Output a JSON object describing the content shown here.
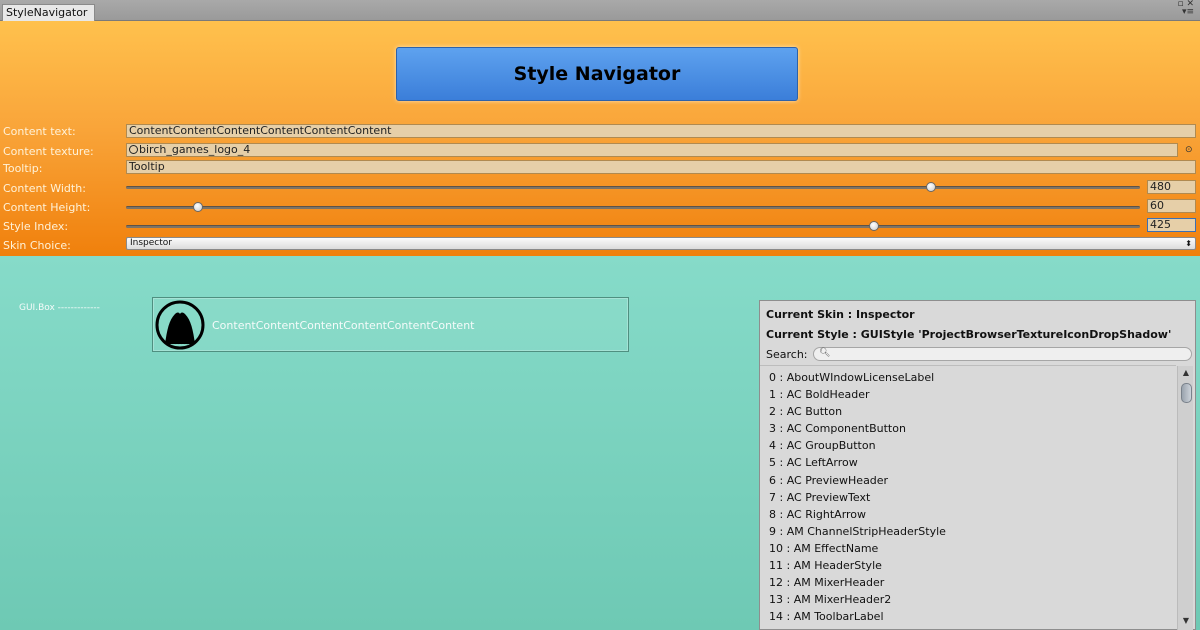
{
  "window": {
    "tab_title": "StyleNavigator",
    "controls": "▫ ✕\n▾≡"
  },
  "header": {
    "title_button": "Style Navigator"
  },
  "fields": {
    "content_text": {
      "label": "Content text:",
      "value": "ContentContentContentContentContentContent"
    },
    "content_texture": {
      "label": "Content texture:",
      "value": "birch_games_logo_4",
      "icon": "texture-circle-icon"
    },
    "tooltip": {
      "label": "Tooltip:",
      "value": "Tooltip"
    },
    "content_width": {
      "label": "Content Width:",
      "value": "480",
      "fraction": 0.794
    },
    "content_height": {
      "label": "Content Height:",
      "value": "60",
      "fraction": 0.071
    },
    "style_index": {
      "label": "Style Index:",
      "value": "425",
      "fraction": 0.738
    },
    "skin_choice": {
      "label": "Skin Choice:",
      "value": "Inspector"
    }
  },
  "preview": {
    "label": "GUI.Box -------------",
    "content_text": "ContentContentContentContentContentContent",
    "logo_icon": "birch-games-logo-icon"
  },
  "panel": {
    "current_skin": "Current Skin : Inspector",
    "current_style": "Current Style : GUIStyle 'ProjectBrowserTextureIconDropShadow'",
    "search_label": "Search:",
    "search_value": "",
    "items": [
      "0 : AboutWIndowLicenseLabel",
      "1 : AC BoldHeader",
      "2 : AC Button",
      "3 : AC ComponentButton",
      "4 : AC GroupButton",
      "5 : AC LeftArrow",
      "6 : AC PreviewHeader",
      "7 : AC PreviewText",
      "8 : AC RightArrow",
      "9 : AM ChannelStripHeaderStyle",
      "10 : AM EffectName",
      "11 : AM HeaderStyle",
      "12 : AM MixerHeader",
      "13 : AM MixerHeader2",
      "14 : AM ToolbarLabel"
    ],
    "scroll_fraction": 0.01
  }
}
